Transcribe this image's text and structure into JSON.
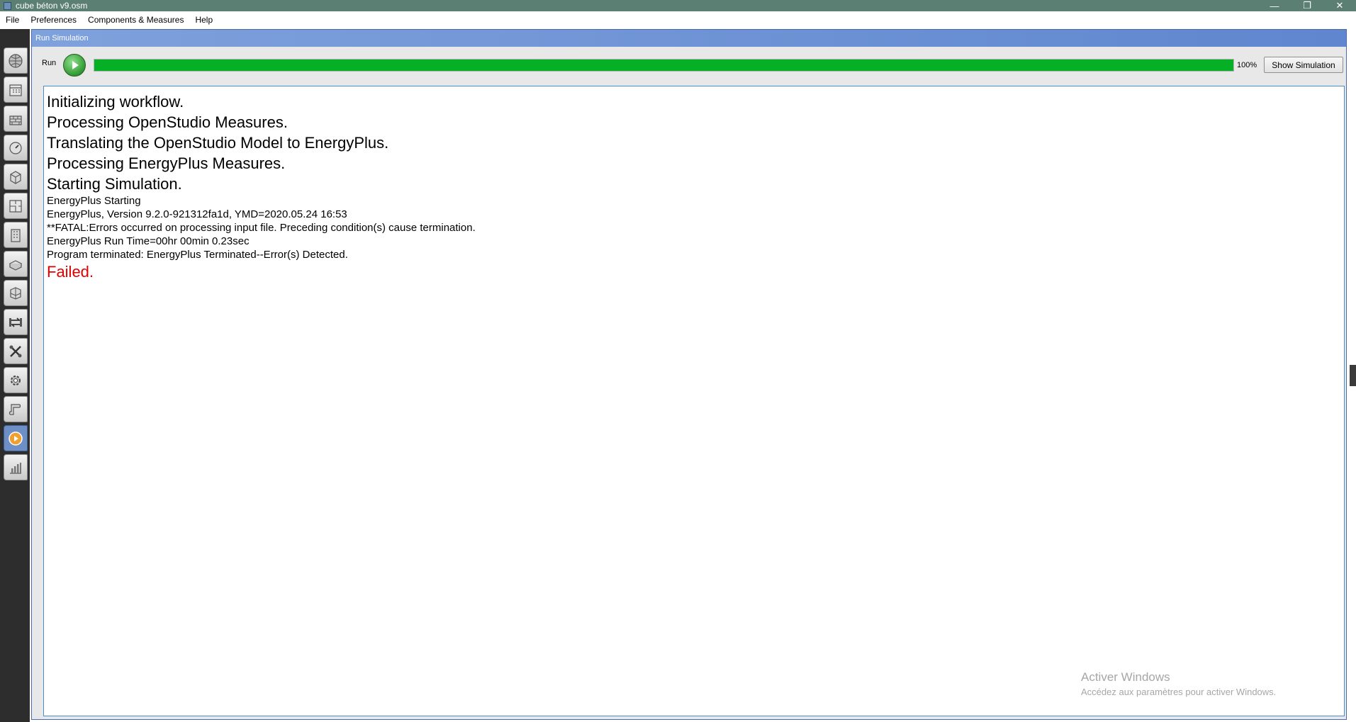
{
  "window": {
    "title": "cube béton v9.osm",
    "controls": {
      "minimize": "—",
      "restore": "❐",
      "close": "✕"
    }
  },
  "menu": [
    "File",
    "Preferences",
    "Components & Measures",
    "Help"
  ],
  "sidebar": {
    "items": [
      {
        "name": "site-tab",
        "icon": "globe-icon",
        "active": false
      },
      {
        "name": "schedules-tab",
        "icon": "calendar-icon",
        "active": false
      },
      {
        "name": "constructions-tab",
        "icon": "bricks-icon",
        "active": false
      },
      {
        "name": "loads-tab",
        "icon": "gauge-icon",
        "active": false
      },
      {
        "name": "space-types-tab",
        "icon": "cube-icon",
        "active": false
      },
      {
        "name": "geometry-tab",
        "icon": "floorplan-icon",
        "active": false
      },
      {
        "name": "facility-tab",
        "icon": "building-icon",
        "active": false
      },
      {
        "name": "spaces-tab",
        "icon": "box-icon",
        "active": false
      },
      {
        "name": "thermal-zones-tab",
        "icon": "zones-icon",
        "active": false
      },
      {
        "name": "hvac-systems-tab",
        "icon": "loop-icon",
        "active": false
      },
      {
        "name": "output-variables-tab",
        "icon": "tools-icon",
        "active": false
      },
      {
        "name": "simulation-settings-tab",
        "icon": "gear-icon",
        "active": false
      },
      {
        "name": "measures-tab",
        "icon": "script-icon",
        "active": false
      },
      {
        "name": "run-simulation-tab",
        "icon": "run-icon",
        "active": true
      },
      {
        "name": "results-summary-tab",
        "icon": "bar-chart-icon",
        "active": false
      }
    ]
  },
  "panel": {
    "header": "Run Simulation",
    "run_label": "Run",
    "progress": {
      "value": 100,
      "label": "100%"
    },
    "show_simulation_label": "Show Simulation"
  },
  "log": {
    "big_lines": [
      "Initializing workflow.",
      "Processing OpenStudio Measures.",
      "Translating the OpenStudio Model to EnergyPlus.",
      "Processing EnergyPlus Measures.",
      "Starting Simulation."
    ],
    "small_lines": [
      "EnergyPlus Starting",
      "EnergyPlus, Version 9.2.0-921312fa1d, YMD=2020.05.24 16:53",
      "**FATAL:Errors occurred on processing input file. Preceding condition(s) cause termination.",
      "EnergyPlus Run Time=00hr 00min  0.23sec",
      "Program terminated: EnergyPlus Terminated--Error(s) Detected."
    ],
    "status": "Failed.",
    "status_color": "#e00000"
  },
  "watermark": {
    "title": "Activer Windows",
    "subtitle": "Accédez aux paramètres pour activer Windows."
  },
  "colors": {
    "titlebar": "#5b7f73",
    "panel_header": "#6f93d6",
    "progress_fill": "#06b025"
  }
}
